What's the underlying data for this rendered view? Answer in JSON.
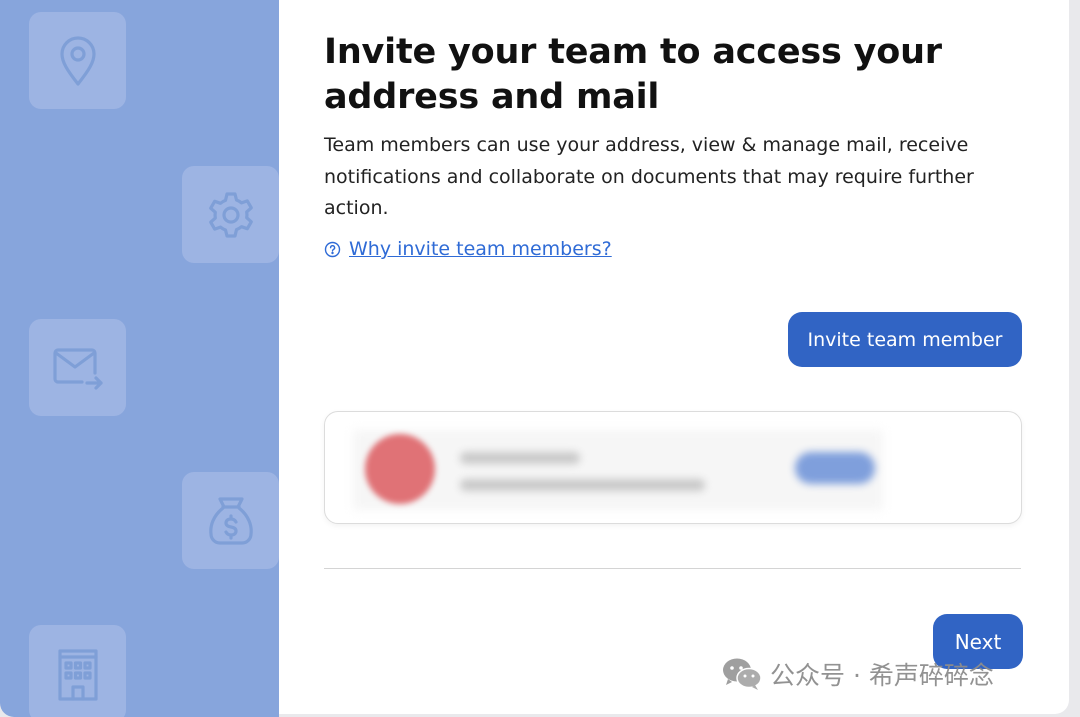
{
  "sidebar": {
    "icons": [
      "location-pin-icon",
      "gear-icon",
      "mail-forward-icon",
      "money-bag-icon",
      "building-icon"
    ]
  },
  "main": {
    "title": "Invite your team to access your address and mail",
    "description": "Team members can use your address, view & manage mail, receive notifications and collaborate on documents that may require further action.",
    "help_link": "Why invite team members?",
    "invite_button": "Invite team member",
    "next_button": "Next"
  },
  "watermark": {
    "text": "公众号 · 希声碎碎念"
  },
  "colors": {
    "sidebar_bg": "#87a5dc",
    "tile_bg": "#9db4e3",
    "accent": "#3164c4",
    "link": "#2f6bd6"
  }
}
